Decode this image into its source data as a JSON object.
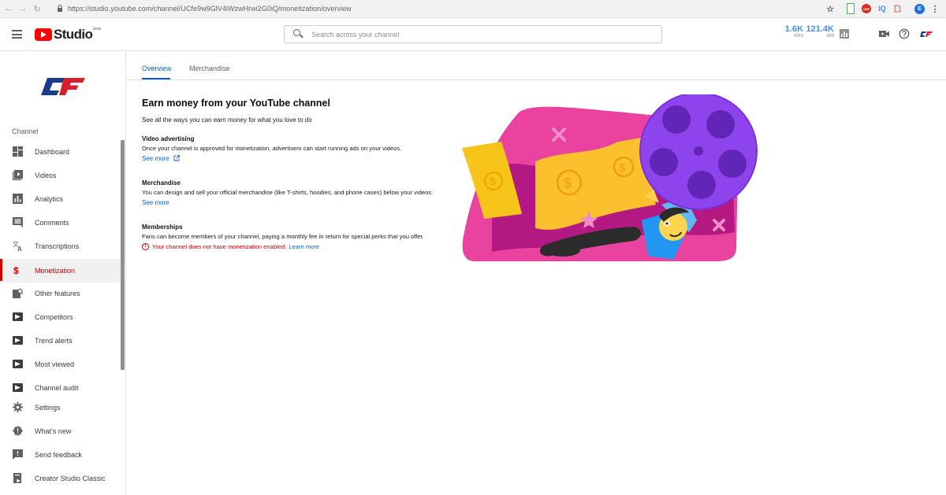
{
  "browser": {
    "url": "https://studio.youtube.com/channel/UCfe9w9GlV4iWzwHrwi2G0iQ/monetization/overview",
    "back": "←",
    "forward": "→",
    "reload": "↻",
    "ext_iq": "IQ",
    "profile_initial": "E"
  },
  "header": {
    "logo_text": "Studio",
    "logo_beta": "beta",
    "search_placeholder": "Search across your channel",
    "stats": [
      {
        "value": "1.6K",
        "label": "60m"
      },
      {
        "value": "121.4K",
        "label": "48h"
      }
    ]
  },
  "sidebar": {
    "heading": "Channel",
    "items": [
      {
        "label": "Dashboard",
        "icon": "dashboard-icon"
      },
      {
        "label": "Videos",
        "icon": "videos-icon"
      },
      {
        "label": "Analytics",
        "icon": "analytics-icon"
      },
      {
        "label": "Comments",
        "icon": "comments-icon"
      },
      {
        "label": "Transcriptions",
        "icon": "translate-icon"
      },
      {
        "label": "Monetization",
        "icon": "dollar-icon"
      },
      {
        "label": "Other features",
        "icon": "other-features-icon"
      },
      {
        "label": "Competitors",
        "icon": "extension-icon"
      },
      {
        "label": "Trend alerts",
        "icon": "extension-icon"
      },
      {
        "label": "Most viewed",
        "icon": "extension-icon"
      },
      {
        "label": "Channel audit",
        "icon": "extension-icon"
      },
      {
        "label": "Settings",
        "icon": "gear-icon"
      },
      {
        "label": "What's new",
        "icon": "whats-new-icon"
      },
      {
        "label": "Send feedback",
        "icon": "feedback-icon"
      },
      {
        "label": "Creator Studio Classic",
        "icon": "classic-icon"
      }
    ]
  },
  "tabs": [
    {
      "label": "Overview"
    },
    {
      "label": "Merchandise"
    }
  ],
  "main": {
    "title": "Earn money from your YouTube channel",
    "subtitle": "See all the ways you can earn money for what you love to do",
    "video_advertising": {
      "title": "Video advertising",
      "body": "Once your channel is approved for monetization, advertisers can start running ads on your videos.",
      "link": "See more"
    },
    "merchandise": {
      "title": "Merchandise",
      "body": "You can design and sell your official merchandise (like T-shirts, hoodies, and phone cases) below your videos.",
      "link": "See more"
    },
    "memberships": {
      "title": "Memberships",
      "body": "Fans can become members of your channel, paying a monthly fee in return for special perks that you offer.",
      "warning": "Your channel does not have monetization enabled.",
      "warning_link": "Learn more"
    }
  },
  "colors": {
    "accent_blue": "#065fd4",
    "active_red": "#cc0000",
    "yt_red": "#ff0000"
  }
}
